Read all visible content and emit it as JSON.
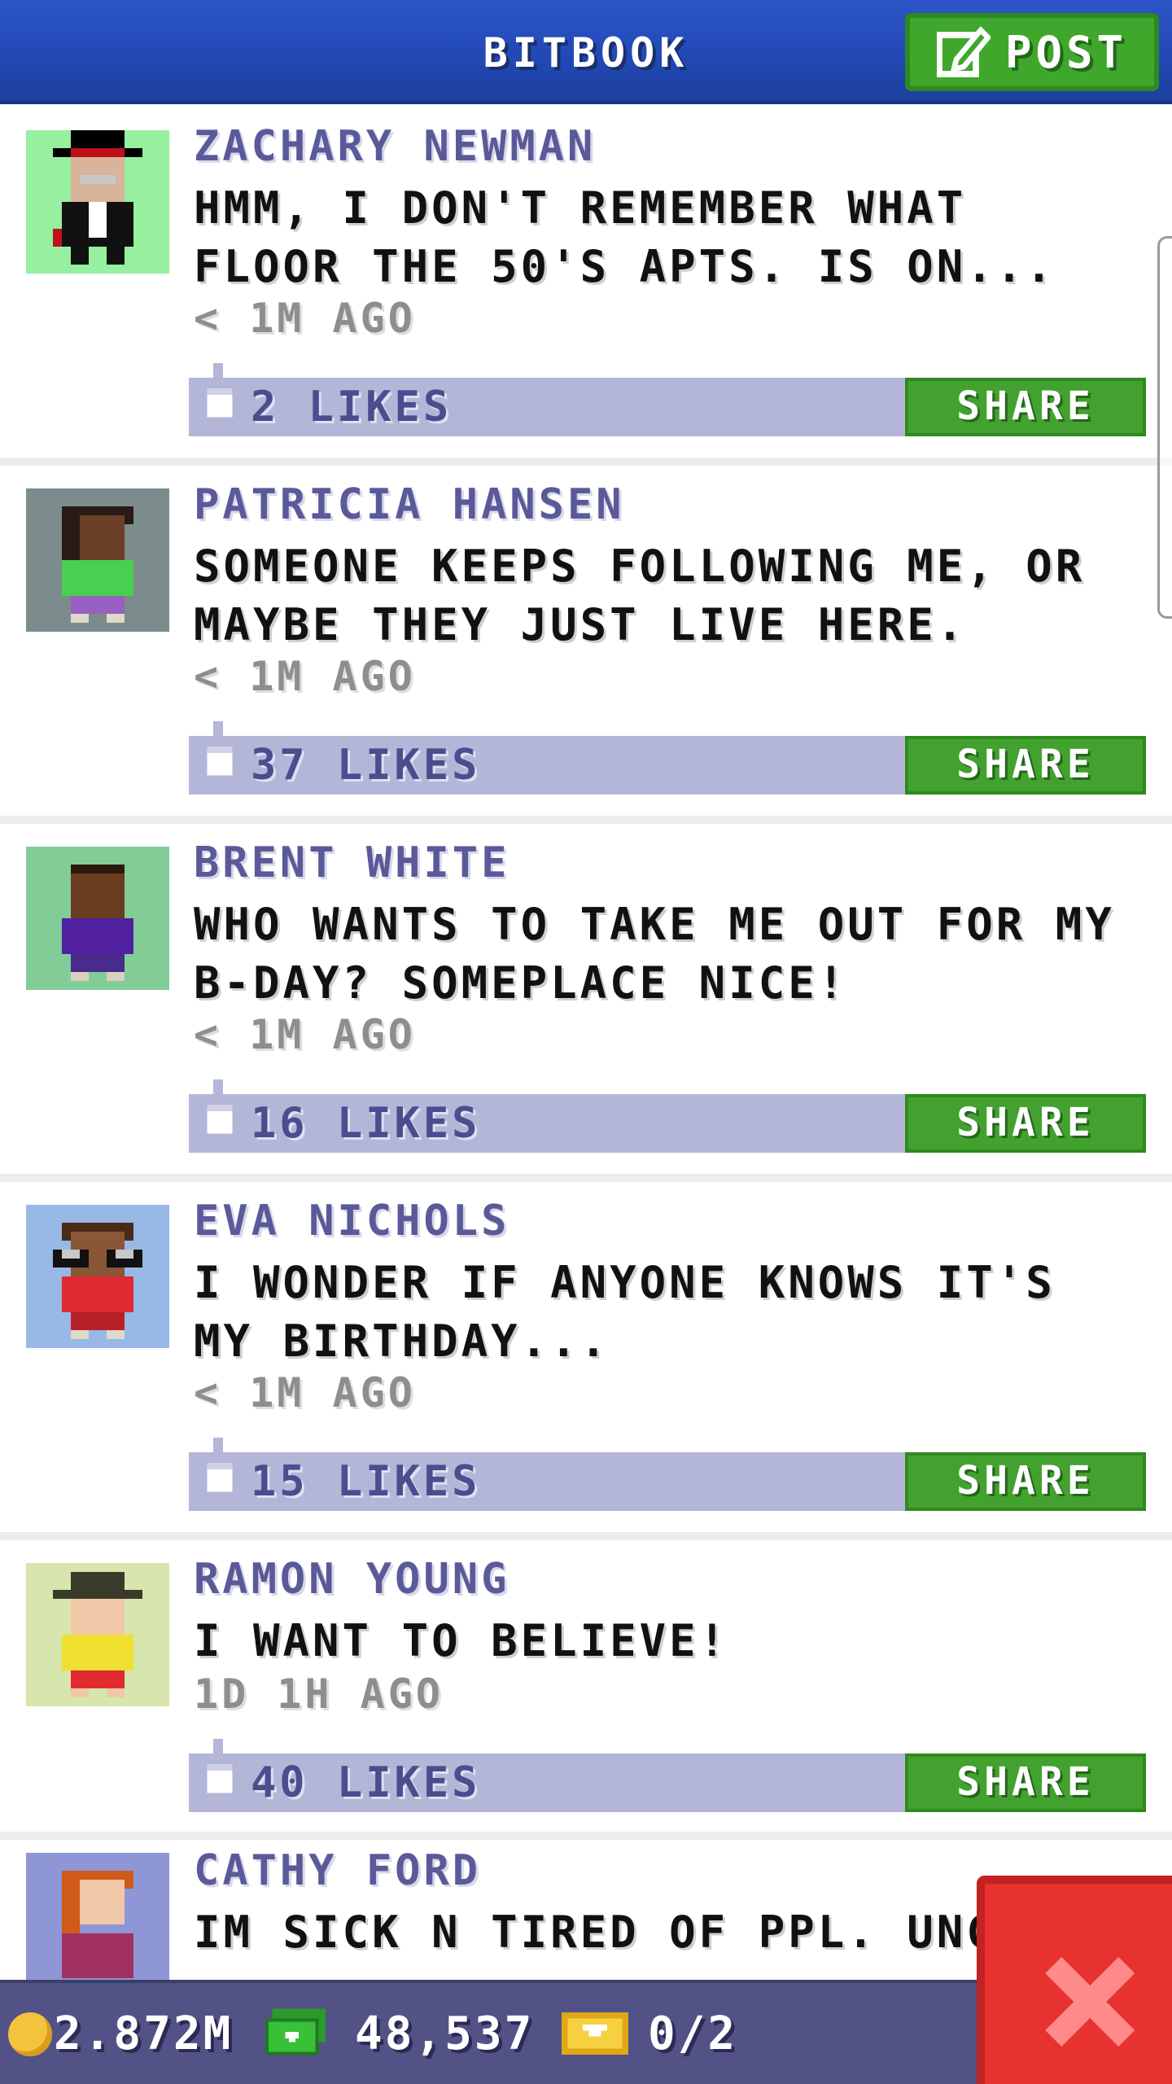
{
  "header": {
    "title": "BITBOOK",
    "post_label": "POST"
  },
  "posts": [
    {
      "author": "ZACHARY NEWMAN",
      "message": "HMM, I DON'T REMEMBER WHAT FLOOR THE 50'S APTS. IS ON...",
      "time": "< 1M AGO",
      "likes": "2 LIKES",
      "share_label": "SHARE",
      "avatar_bg": "#96f0a0"
    },
    {
      "author": "PATRICIA HANSEN",
      "message": "SOMEONE KEEPS FOLLOWING ME, OR MAYBE THEY JUST LIVE HERE.",
      "time": "< 1M AGO",
      "likes": "37 LIKES",
      "share_label": "SHARE",
      "avatar_bg": "#7c8c8c"
    },
    {
      "author": "BRENT WHITE",
      "message": "WHO WANTS TO TAKE ME OUT FOR MY B-DAY? SOMEPLACE NICE!",
      "time": "< 1M AGO",
      "likes": "16 LIKES",
      "share_label": "SHARE",
      "avatar_bg": "#82cc98"
    },
    {
      "author": "EVA NICHOLS",
      "message": "I WONDER IF ANYONE KNOWS IT'S MY BIRTHDAY...",
      "time": "< 1M AGO",
      "likes": "15 LIKES",
      "share_label": "SHARE",
      "avatar_bg": "#98b8e6"
    },
    {
      "author": "RAMON YOUNG",
      "message": "I WANT TO BELIEVE!",
      "time": "1D 1H AGO",
      "likes": "40 LIKES",
      "share_label": "SHARE",
      "avatar_bg": "#d6e6ac"
    },
    {
      "author": "CATHY FORD",
      "message": "IM SICK N TIRED OF PPL. UNCOR",
      "time": "",
      "likes": "",
      "share_label": "",
      "avatar_bg": "#8e96d6"
    }
  ],
  "status": {
    "coins": "2.872M",
    "bux": "48,537",
    "tickets": "0/2"
  },
  "colors": {
    "header_blue": "#2148b4",
    "accent_green": "#43a12f",
    "like_bar": "#b4b6d8",
    "close_red": "#e8322f"
  },
  "icons": {
    "post": "edit-icon",
    "like": "thumbs-up-icon",
    "coin": "coin-icon",
    "bux": "cash-icon",
    "ticket": "ticket-icon",
    "close": "close-icon"
  }
}
